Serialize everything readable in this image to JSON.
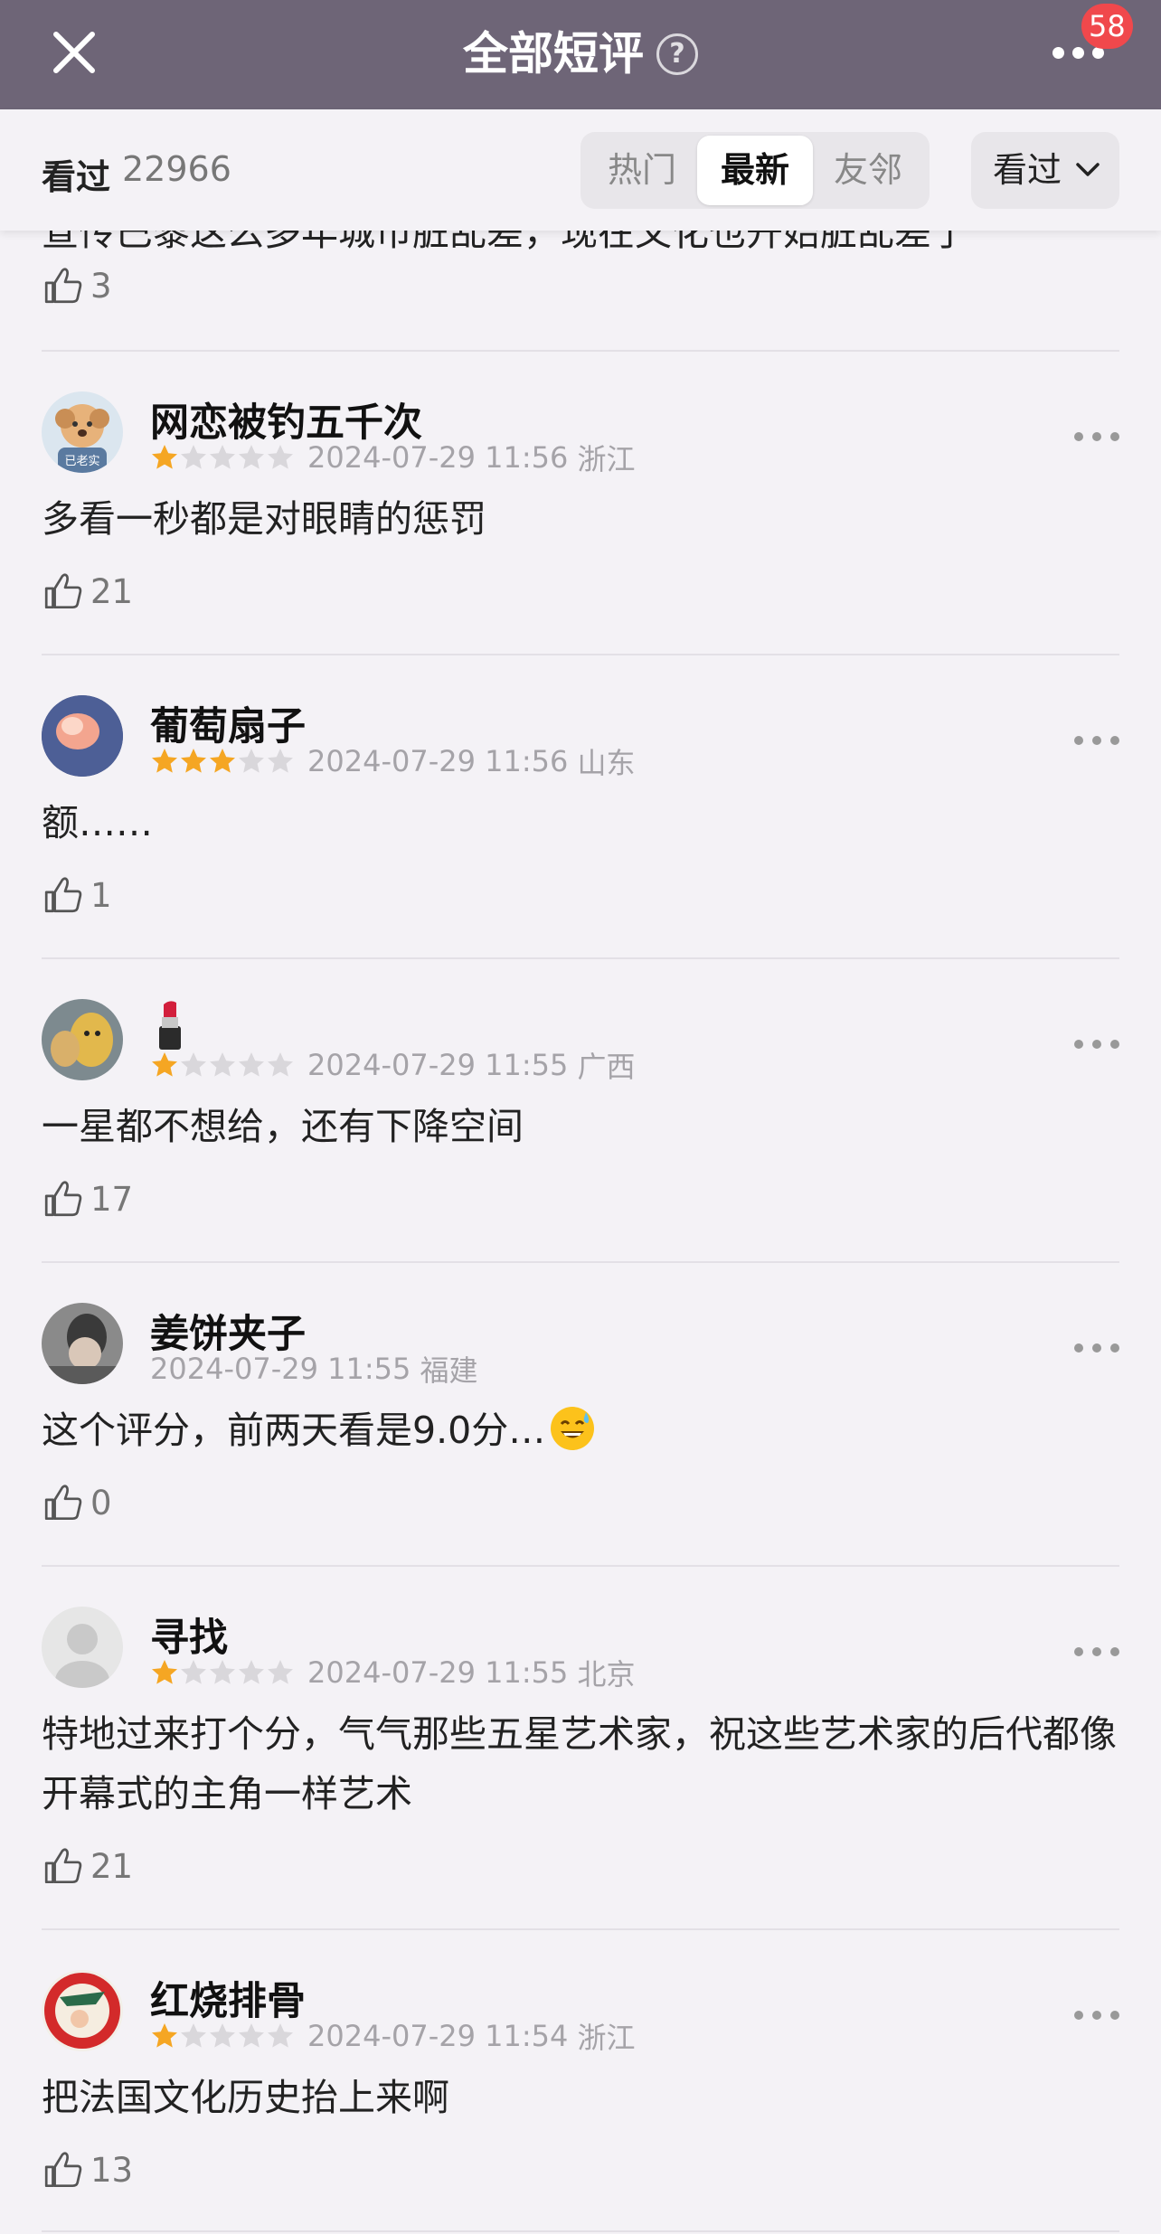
{
  "header": {
    "title": "全部短评",
    "help_icon": "question-circle-icon",
    "close_icon": "close-icon",
    "more_icon": "more-horizontal-icon",
    "badge_count": "58",
    "background_color": "#6e6577"
  },
  "filter": {
    "watched_label": "看过",
    "watched_count": "22966",
    "tabs": [
      {
        "label": "热门",
        "active": false
      },
      {
        "label": "最新",
        "active": true
      },
      {
        "label": "友邻",
        "active": false
      }
    ],
    "dropdown_label": "看过",
    "dropdown_icon": "chevron-down-icon"
  },
  "partial_review": {
    "text": "宣传巴黎这么多年城市脏乱差，现在文化也开始脏乱差了",
    "likes": "3"
  },
  "reviews": [
    {
      "user": "网恋被钓五千次",
      "stars": 1,
      "time": "2024-07-29 11:56",
      "location": "浙江",
      "text": "多看一秒都是对眼睛的惩罚",
      "likes": "21",
      "avatar_text": "已老实"
    },
    {
      "user": "葡萄扇子",
      "stars": 3,
      "time": "2024-07-29 11:56",
      "location": "山东",
      "text": "额……",
      "likes": "1"
    },
    {
      "user": "💄",
      "stars": 1,
      "time": "2024-07-29 11:55",
      "location": "广西",
      "text": "一星都不想给，还有下降空间",
      "likes": "17"
    },
    {
      "user": "姜饼夹子",
      "stars": 0,
      "time": "2024-07-29 11:55",
      "location": "福建",
      "text": "这个评分，前两天看是9.0分…",
      "likes": "0",
      "emoji": "sweat-smile-emoji"
    },
    {
      "user": "寻找",
      "stars": 1,
      "time": "2024-07-29 11:55",
      "location": "北京",
      "text": "特地过来打个分，气气那些五星艺术家，祝这些艺术家的后代都像开幕式的主角一样艺术",
      "likes": "21"
    },
    {
      "user": "红烧排骨",
      "stars": 1,
      "time": "2024-07-29 11:54",
      "location": "浙江",
      "text": "把法国文化历史抬上来啊",
      "likes": "13"
    }
  ],
  "colors": {
    "star_on": "#f5a623",
    "star_off": "#d9d7db",
    "badge": "#f0484c"
  }
}
